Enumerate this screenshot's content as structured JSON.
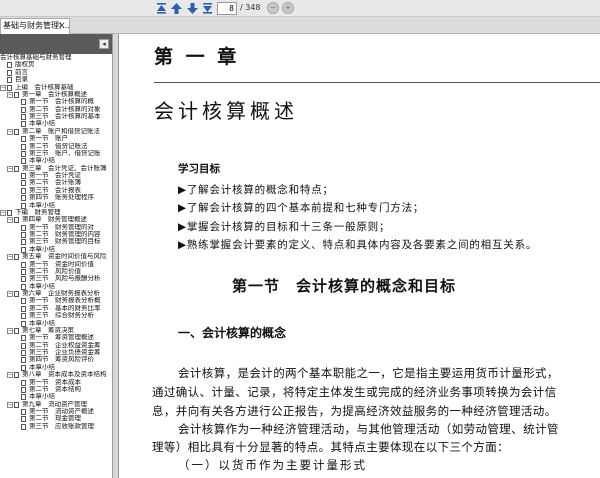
{
  "toolbar": {
    "first_icon": "first-page-icon",
    "prev_icon": "prev-page-icon",
    "next_icon": "next-page-icon",
    "last_icon": "last-page-icon",
    "page_current": "8",
    "page_total": "/ 348"
  },
  "tab": {
    "title": "基础与财务管理)...",
    "close": "×"
  },
  "sidebar": {
    "collapse": "◂",
    "items": [
      {
        "label": "会计核算基础与财务管理",
        "indent": 0,
        "toggle": "",
        "icon": false
      },
      {
        "label": "版权页",
        "indent": 1,
        "toggle": "",
        "icon": true
      },
      {
        "label": "前言",
        "indent": 1,
        "toggle": "",
        "icon": true
      },
      {
        "label": "目录",
        "indent": 1,
        "toggle": "",
        "icon": true
      },
      {
        "label": "上编　会计核算基础",
        "indent": 1,
        "toggle": "−",
        "icon": true
      },
      {
        "label": "第一章　会计核算概述",
        "indent": 2,
        "toggle": "−",
        "icon": true
      },
      {
        "label": "第一节　会计核算的概",
        "indent": 3,
        "toggle": "",
        "icon": true
      },
      {
        "label": "第二节　会计核算的对象",
        "indent": 3,
        "toggle": "",
        "icon": true
      },
      {
        "label": "第三节　会计核算的基本",
        "indent": 3,
        "toggle": "",
        "icon": true
      },
      {
        "label": "本章小结",
        "indent": 3,
        "toggle": "",
        "icon": true
      },
      {
        "label": "第二章　账户和借贷记账法",
        "indent": 2,
        "toggle": "−",
        "icon": true
      },
      {
        "label": "第一节　账户",
        "indent": 3,
        "toggle": "",
        "icon": true
      },
      {
        "label": "第二节　借贷记账法",
        "indent": 3,
        "toggle": "",
        "icon": true
      },
      {
        "label": "第三节　账户、借贷记账",
        "indent": 3,
        "toggle": "",
        "icon": true
      },
      {
        "label": "本章小结",
        "indent": 3,
        "toggle": "",
        "icon": true
      },
      {
        "label": "第三章　会计凭证、会计账簿",
        "indent": 2,
        "toggle": "−",
        "icon": true
      },
      {
        "label": "第一节　会计凭证",
        "indent": 3,
        "toggle": "",
        "icon": true
      },
      {
        "label": "第二节　会计账簿",
        "indent": 3,
        "toggle": "",
        "icon": true
      },
      {
        "label": "第三节　会计报表",
        "indent": 3,
        "toggle": "",
        "icon": true
      },
      {
        "label": "第四节　账务处理程序",
        "indent": 3,
        "toggle": "",
        "icon": true
      },
      {
        "label": "本章小结",
        "indent": 3,
        "toggle": "",
        "icon": true
      },
      {
        "label": "下编　财务管理",
        "indent": 1,
        "toggle": "−",
        "icon": true
      },
      {
        "label": "第四章　财务管理概述",
        "indent": 2,
        "toggle": "−",
        "icon": true
      },
      {
        "label": "第一节　财务管理的对",
        "indent": 3,
        "toggle": "",
        "icon": true
      },
      {
        "label": "第二节　财务管理的内容",
        "indent": 3,
        "toggle": "",
        "icon": true
      },
      {
        "label": "第三节　财务管理的目标",
        "indent": 3,
        "toggle": "",
        "icon": true
      },
      {
        "label": "本章小结",
        "indent": 3,
        "toggle": "",
        "icon": true
      },
      {
        "label": "第五章　资金时间价值与风险",
        "indent": 2,
        "toggle": "−",
        "icon": true
      },
      {
        "label": "第一节　资金时间价值",
        "indent": 3,
        "toggle": "",
        "icon": true
      },
      {
        "label": "第二节　风险价值",
        "indent": 3,
        "toggle": "",
        "icon": true
      },
      {
        "label": "第三节　风险与报酬分析",
        "indent": 3,
        "toggle": "",
        "icon": true
      },
      {
        "label": "本章小结",
        "indent": 3,
        "toggle": "",
        "icon": true
      },
      {
        "label": "第六章　企业财务报表分析",
        "indent": 2,
        "toggle": "−",
        "icon": true
      },
      {
        "label": "第一节　财务报表分析概",
        "indent": 3,
        "toggle": "",
        "icon": true
      },
      {
        "label": "第二节　基本的财务比率",
        "indent": 3,
        "toggle": "",
        "icon": true
      },
      {
        "label": "第三节　综合财务分析",
        "indent": 3,
        "toggle": "",
        "icon": true
      },
      {
        "label": "本章小结",
        "indent": 3,
        "toggle": "",
        "icon": true
      },
      {
        "label": "第七章　筹资决策",
        "indent": 2,
        "toggle": "−",
        "icon": true
      },
      {
        "label": "第一节　筹资管理概述",
        "indent": 3,
        "toggle": "",
        "icon": true
      },
      {
        "label": "第二节　企业权益资金筹",
        "indent": 3,
        "toggle": "",
        "icon": true
      },
      {
        "label": "第三节　企业负债资金筹",
        "indent": 3,
        "toggle": "",
        "icon": true
      },
      {
        "label": "第四节　筹资风险评价",
        "indent": 3,
        "toggle": "",
        "icon": true
      },
      {
        "label": "本章小结",
        "indent": 3,
        "toggle": "",
        "icon": true
      },
      {
        "label": "第八章　资本成本及资本结构",
        "indent": 2,
        "toggle": "−",
        "icon": true
      },
      {
        "label": "第一节　资本成本",
        "indent": 3,
        "toggle": "",
        "icon": true
      },
      {
        "label": "第二节　资本结构",
        "indent": 3,
        "toggle": "",
        "icon": true
      },
      {
        "label": "本章小结",
        "indent": 3,
        "toggle": "",
        "icon": true
      },
      {
        "label": "第九章　流动资产管理",
        "indent": 2,
        "toggle": "−",
        "icon": true
      },
      {
        "label": "第一节　流动资产概述",
        "indent": 3,
        "toggle": "",
        "icon": true
      },
      {
        "label": "第二节　现金管理",
        "indent": 3,
        "toggle": "",
        "icon": true
      },
      {
        "label": "第三节　应收账款管理",
        "indent": 3,
        "toggle": "",
        "icon": true
      }
    ]
  },
  "content": {
    "chapter_label": "第 一 章",
    "chapter_title": "会计核算概述",
    "objectives_heading": "学习目标",
    "objectives": [
      "▶了解会计核算的概念和特点；",
      "▶了解会计核算的四个基本前提和七种专门方法；",
      "▶掌握会计核算的目标和十三条一般原则；",
      "▶熟练掌握会计要素的定义、特点和具体内容及各要素之间的相互关系。"
    ],
    "section_title": "第一节　会计核算的概念和目标",
    "sub_heading": "一、会计核算的概念",
    "paragraphs": [
      "会计核算，是会计的两个基本职能之一，它是指主要运用货币计量形式，",
      "通过确认、计量、记录，将特定主体发生或完成的经济业务事项转换为会计信",
      "息，并向有关各方进行公正报告，为提高经济效益服务的一种经济管理活动。",
      "会计核算作为一种经济管理活动，与其他管理活动（如劳动管理、统计管",
      "理等）相比具有十分显著的特点。其特点主要体现在以下三个方面："
    ],
    "list_head": "（一）以货币作为主要计量形式"
  }
}
